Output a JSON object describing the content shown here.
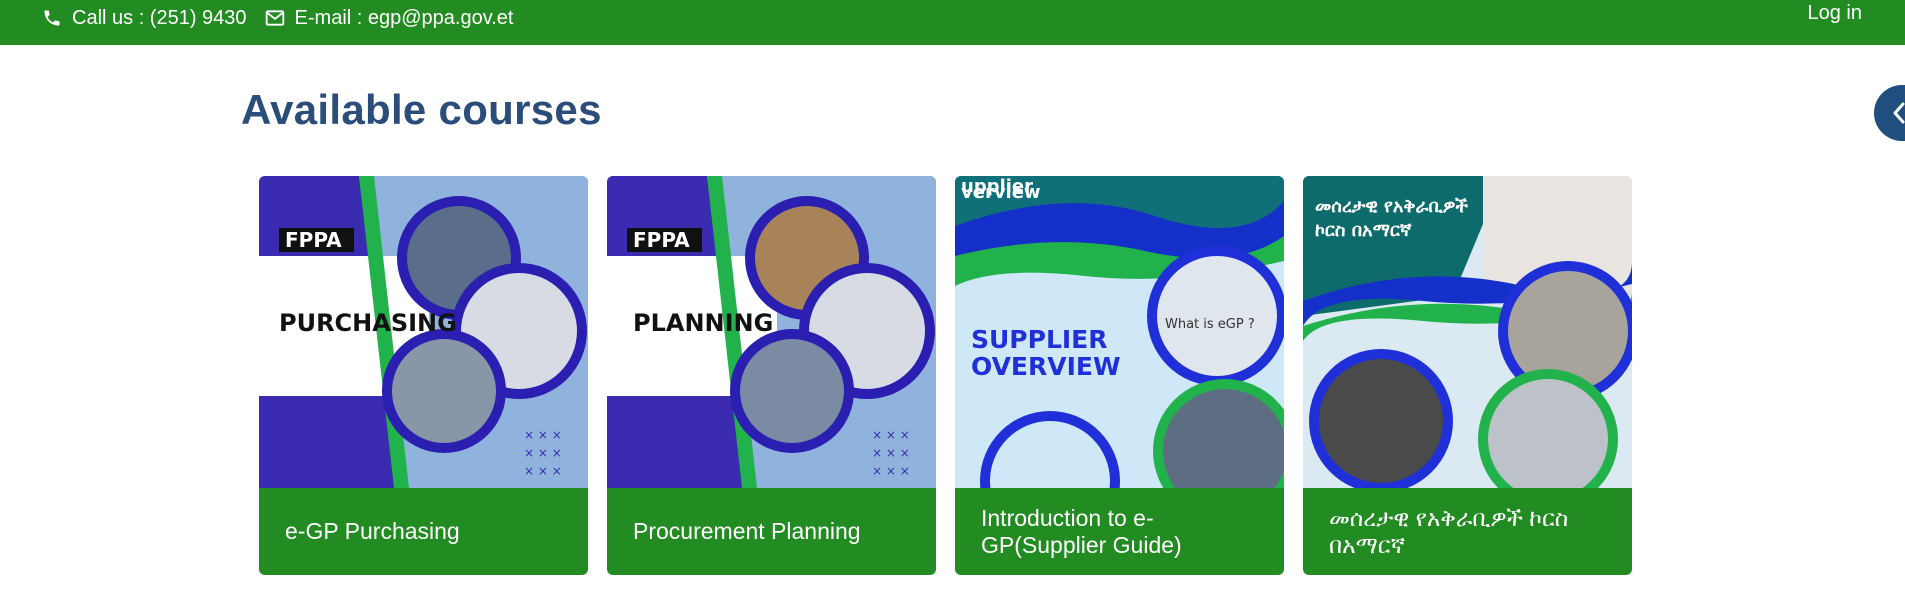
{
  "topbar": {
    "phone_text": "Call us : (251) 9430",
    "email_text": "E-mail : egp@ppa.gov.et",
    "login_label": "Log in"
  },
  "main": {
    "heading": "Available courses"
  },
  "courses": [
    {
      "title": "e-GP Purchasing",
      "image_text": {
        "logo": "FPPA",
        "banner": "PURCHASING"
      }
    },
    {
      "title": "Procurement Planning",
      "image_text": {
        "logo": "FPPA",
        "banner": "PLANNING"
      }
    },
    {
      "title": "Introduction to e-GP(Supplier Guide)",
      "image_text": {
        "banner_top": "upplier",
        "banner_top2": "verview",
        "headline1": "SUPPLIER",
        "headline2": "OVERVIEW",
        "screen": "What is eGP ?"
      }
    },
    {
      "title": "መሰረታዊ የአቅራቢዎች ኮርስ በአማርኛ",
      "image_text": {
        "line1": "መሰረታዊ የአቅራቢዎች",
        "line2": "ኮርስ በአማርኛ"
      }
    }
  ],
  "colors": {
    "topbar": "#228b22",
    "heading": "#2a4d7a",
    "card_footer": "#228b22",
    "drawer_toggle": "#1f4e7f"
  },
  "icons": [
    "phone-icon",
    "envelope-icon",
    "chevron-left-icon"
  ]
}
